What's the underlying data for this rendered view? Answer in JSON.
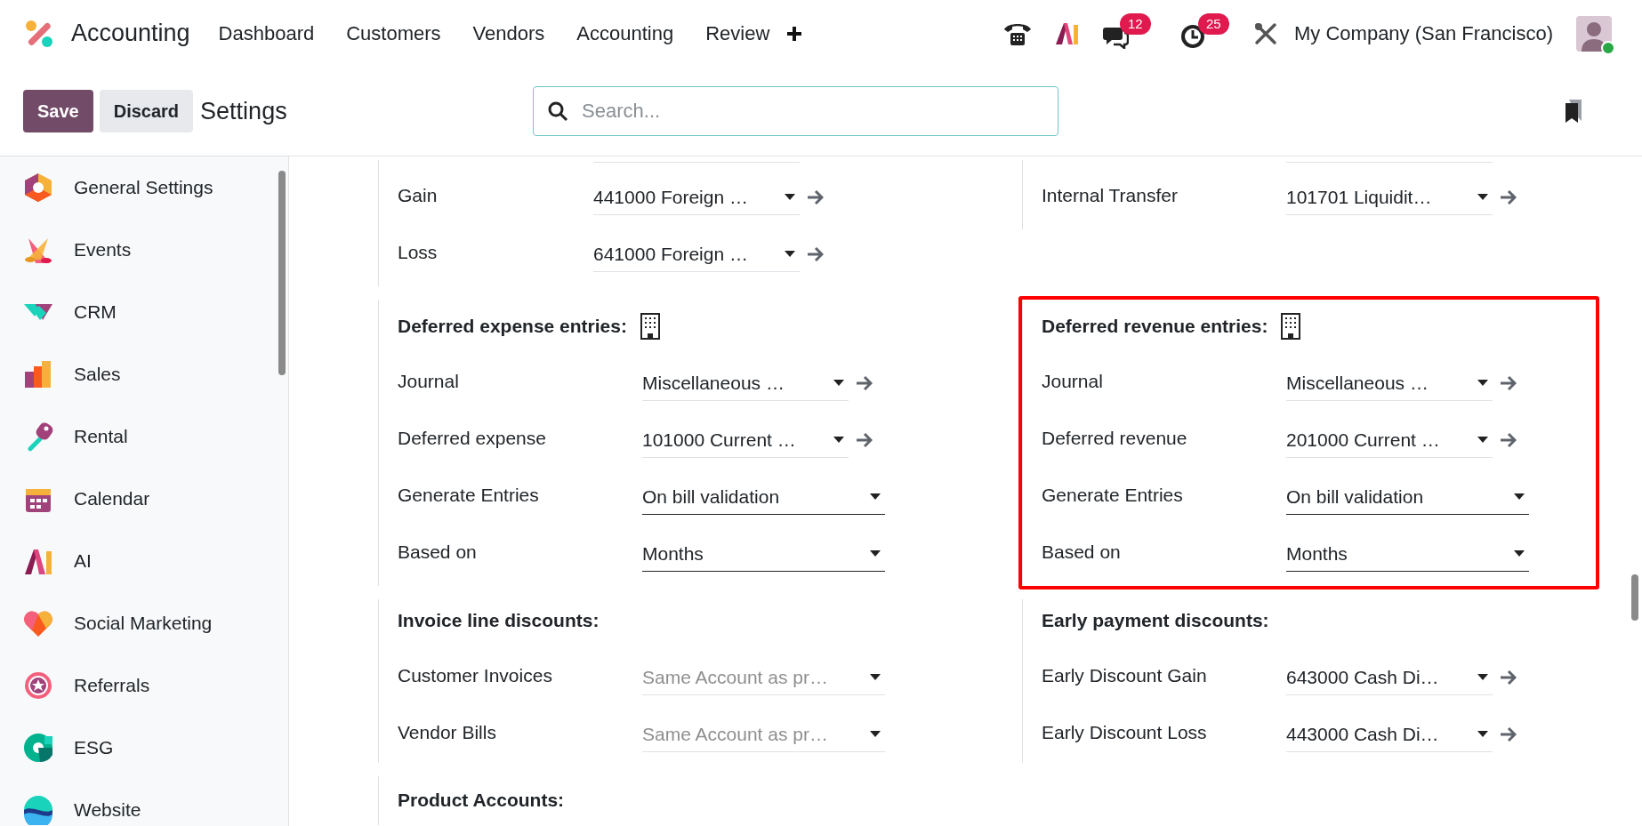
{
  "navbar": {
    "app_name": "Accounting",
    "menu": [
      "Dashboard",
      "Customers",
      "Vendors",
      "Accounting",
      "Review"
    ],
    "messages_badge": "12",
    "activities_badge": "25",
    "company": "My Company (San Francisco)",
    "user_online": true
  },
  "control_bar": {
    "save": "Save",
    "discard": "Discard",
    "breadcrumb": "Settings",
    "search": {
      "placeholder": "Search..."
    }
  },
  "sidebar": {
    "items": [
      {
        "label": "General Settings"
      },
      {
        "label": "Events"
      },
      {
        "label": "CRM"
      },
      {
        "label": "Sales"
      },
      {
        "label": "Rental"
      },
      {
        "label": "Calendar"
      },
      {
        "label": "AI"
      },
      {
        "label": "Social Marketing"
      },
      {
        "label": "Referrals"
      },
      {
        "label": "ESG"
      },
      {
        "label": "Website"
      }
    ]
  },
  "sections": [
    {
      "left": {
        "company_specific": false,
        "highlighted": false,
        "fields": [
          {
            "label": "Gain",
            "kind": "many2one",
            "required": false,
            "value": "441000 Foreign …"
          },
          {
            "label": "Loss",
            "kind": "many2one",
            "required": false,
            "value": "641000 Foreign …"
          }
        ]
      },
      "right": {
        "company_specific": false,
        "highlighted": false,
        "fields": [
          {
            "label": "Internal Transfer",
            "kind": "many2one",
            "required": false,
            "value": "101701 Liquidit…"
          }
        ]
      }
    },
    {
      "left": {
        "title": "Deferred expense entries:",
        "company_specific": true,
        "highlighted": false,
        "fields": [
          {
            "label": "Journal",
            "kind": "many2one",
            "required": false,
            "value": "Miscellaneous …"
          },
          {
            "label": "Deferred expense",
            "kind": "many2one",
            "required": false,
            "value": "101000 Current …"
          },
          {
            "label": "Generate Entries",
            "kind": "selection",
            "required": true,
            "value": "On bill validation"
          },
          {
            "label": "Based on",
            "kind": "selection",
            "required": true,
            "value": "Months"
          }
        ]
      },
      "right": {
        "title": "Deferred revenue entries:",
        "company_specific": true,
        "highlighted": true,
        "fields": [
          {
            "label": "Journal",
            "kind": "many2one",
            "required": false,
            "value": "Miscellaneous …"
          },
          {
            "label": "Deferred revenue",
            "kind": "many2one",
            "required": false,
            "value": "201000 Current …"
          },
          {
            "label": "Generate Entries",
            "kind": "selection",
            "required": true,
            "value": "On bill validation"
          },
          {
            "label": "Based on",
            "kind": "selection",
            "required": true,
            "value": "Months"
          }
        ]
      }
    },
    {
      "left": {
        "title": "Invoice line discounts:",
        "company_specific": false,
        "highlighted": false,
        "fields": [
          {
            "label": "Customer Invoices",
            "kind": "selection",
            "required": false,
            "placeholder": "Same Account as pr…"
          },
          {
            "label": "Vendor Bills",
            "kind": "selection",
            "required": false,
            "placeholder": "Same Account as pr…"
          }
        ]
      },
      "right": {
        "title": "Early payment discounts:",
        "company_specific": false,
        "highlighted": false,
        "fields": [
          {
            "label": "Early Discount Gain",
            "kind": "many2one",
            "required": false,
            "value": "643000 Cash Di…"
          },
          {
            "label": "Early Discount Loss",
            "kind": "many2one",
            "required": false,
            "value": "443000 Cash Di…"
          }
        ]
      }
    },
    {
      "left": {
        "title": "Product Accounts:",
        "company_specific": false,
        "highlighted": false
      }
    }
  ]
}
